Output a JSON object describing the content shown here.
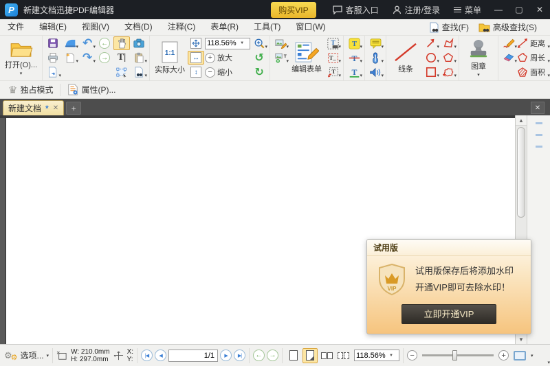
{
  "icons": {
    "caret": "▾",
    "dropdown": "▼",
    "close": "✕",
    "minimize": "—",
    "maximize": "▢",
    "undo": "↶",
    "redo": "↷",
    "back": "←",
    "forward": "→",
    "rotate_left": "↺",
    "rotate_right": "↻",
    "plus": "+",
    "minus": "−",
    "first_page": "|◀",
    "prev_page": "◀",
    "next_page": "▶",
    "last_page": "▶|",
    "up": "▲",
    "down": "▼",
    "t": "T",
    "t_cursor": "T|",
    "one_to_one": "1:1",
    "fit_width": "↔",
    "fit_height": "↕",
    "fit_page": "✛",
    "crown": "♛",
    "gear": "⚙",
    "new_tab": "+",
    "tab_close": "✕"
  },
  "titlebar": {
    "title": "新建文档迅捷PDF编辑器",
    "buy_vip": "购买VIP",
    "support": "客服入口",
    "login": "注册/登录",
    "menu": "菜单"
  },
  "menubar": {
    "items": [
      "文件",
      "编辑(E)",
      "视图(V)",
      "文档(D)",
      "注释(C)",
      "表单(R)",
      "工具(T)",
      "窗口(W)"
    ],
    "find": "查找(F)",
    "advanced_find": "高级查找(S)"
  },
  "toolbar": {
    "open_label": "打开(O)...",
    "actual_size_label": "实际大小",
    "zoom_value": "118.56%",
    "zoom_in_label": "放大",
    "zoom_out_label": "缩小",
    "edit_form_label": "编辑表单",
    "lines_label": "线条",
    "stamp_label": "图章",
    "distance_label": "距离",
    "perimeter_label": "周长",
    "area_label": "面积"
  },
  "toolbar2": {
    "exclusive_mode": "独占模式",
    "properties": "属性(P)..."
  },
  "tabs": {
    "active_title": "新建文档",
    "modified_mark": "*"
  },
  "trial_dialog": {
    "title": "试用版",
    "badge": "VIP",
    "line1": "试用版保存后将添加水印",
    "line2": "开通VIP即可去除水印！",
    "button": "立即开通VIP"
  },
  "statusbar": {
    "options": "选项...",
    "w_label": "W:",
    "w_value": "210.0mm",
    "h_label": "H:",
    "h_value": "297.0mm",
    "x_label": "X:",
    "y_label": "Y:",
    "page_display": "1/1",
    "zoom_value": "118.56%"
  }
}
